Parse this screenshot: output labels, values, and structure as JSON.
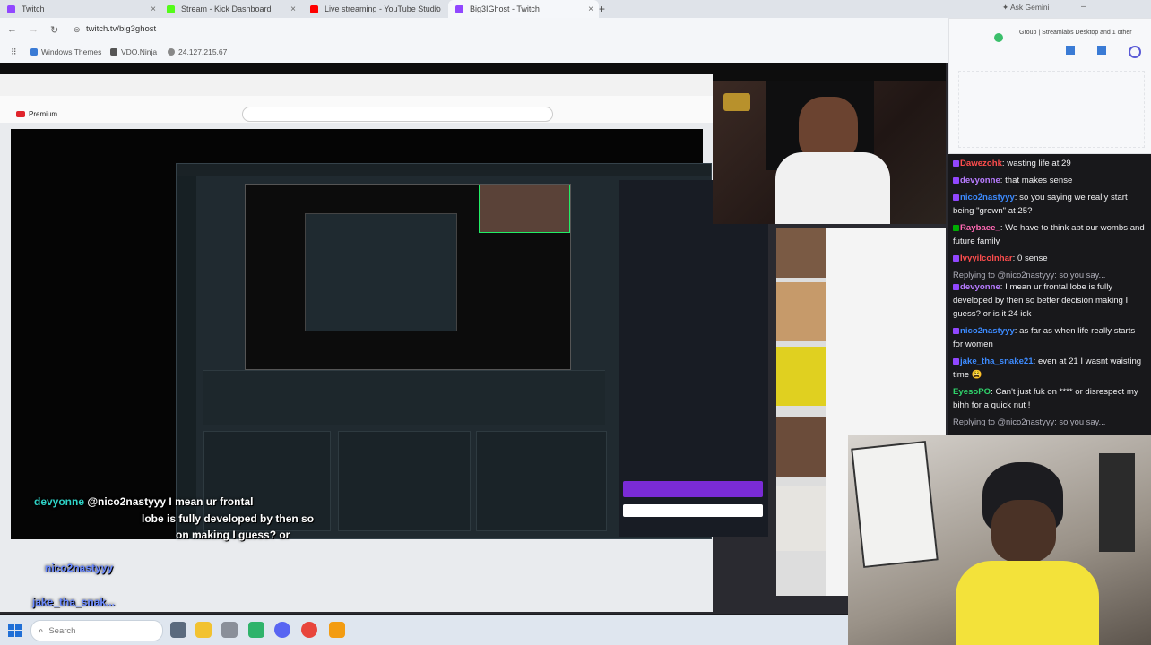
{
  "browser": {
    "tabs": [
      {
        "label": "Twitch",
        "color": "#9147ff"
      },
      {
        "label": "Stream - Kick Dashboard",
        "color": "#53fc18"
      },
      {
        "label": "Live streaming - YouTube Studio",
        "color": "#ff0000"
      },
      {
        "label": "Big3IGhost - Twitch",
        "color": "#9147ff"
      }
    ],
    "url": "twitch.tv/big3ghost",
    "bookmarks": [
      "Windows Themes",
      "VDO.Ninja",
      "24.127.215.67"
    ],
    "ask_gemini": "Ask Gemini"
  },
  "popup": {
    "label": "Group | Streamlabs Desktop and 1 other"
  },
  "inner_youtube": {
    "logo_text": "Premium"
  },
  "chat": [
    {
      "user": "Dawezohk",
      "color": "#ff4d4d",
      "badges": [
        "p"
      ],
      "text": "wasting life at 29"
    },
    {
      "user": "devyonne",
      "color": "#b77cff",
      "badges": [
        "p"
      ],
      "text": "that makes sense"
    },
    {
      "user": "nico2nastyyy",
      "color": "#3d8bff",
      "badges": [
        "p"
      ],
      "text": "so you saying we really start being \"grown\" at 25?"
    },
    {
      "user": "Raybaee_",
      "color": "#ff69b4",
      "badges": [
        "g"
      ],
      "text": "We have to think abt our wombs and future family"
    },
    {
      "user": "IvyyiIcolnhar",
      "color": "#ff4d4d",
      "badges": [
        "p"
      ],
      "text": "0 sense"
    },
    {
      "reply": "Replying to @nico2nastyyy: so you say..."
    },
    {
      "user": "devyonne",
      "color": "#b77cff",
      "badges": [
        "p"
      ],
      "text": "I mean ur frontal lobe is fully developed by then so better decision making I guess? or is it 24 idk"
    },
    {
      "user": "nico2nastyyy",
      "color": "#3d8bff",
      "badges": [
        "p"
      ],
      "text": "as far as when life really starts for women"
    },
    {
      "user": "jake_tha_snake21",
      "color": "#3d8bff",
      "badges": [
        "p"
      ],
      "text": "even at 21 I wasnt waisting time 😩"
    },
    {
      "user": "EyesoPO",
      "color": "#2fd36b",
      "badges": [],
      "text": "Can't just fuk on **** or disrespect my bihh for a quick nut !"
    },
    {
      "reply": "Replying to @nico2nastyyy: so you say..."
    }
  ],
  "captions": {
    "line1_user": "devyonne",
    "line1_text": "@nico2nastyyy I mean ur frontal",
    "line2_text": "lobe is fully developed by then so",
    "line3_text": "on making I guess? or",
    "line4_user": "nico2nastyyy",
    "line5_user": "jake_tha_snak..."
  },
  "taskbar": {
    "search_placeholder": "Search"
  }
}
